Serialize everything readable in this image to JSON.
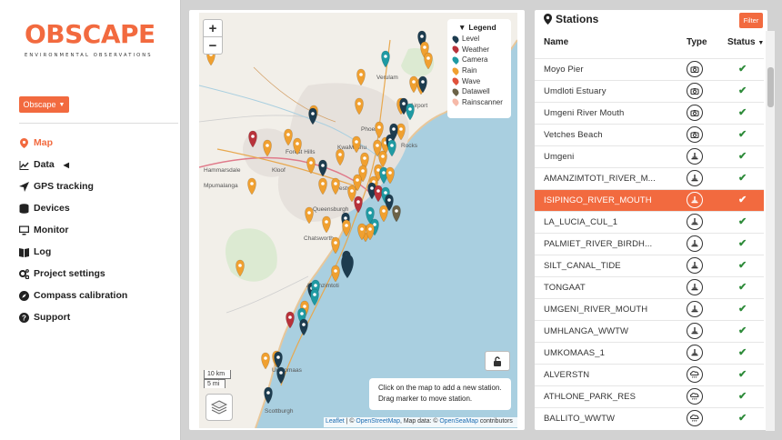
{
  "brand": {
    "name": "OBSCAPE",
    "tagline": "ENVIRONMENTAL OBSERVATIONS",
    "accent": "#f26a3f"
  },
  "org_select": {
    "label": "Obscape"
  },
  "nav": [
    {
      "label": "Map",
      "icon": "map-marker-icon",
      "active": true
    },
    {
      "label": "Data",
      "icon": "chart-icon",
      "expand": "◀"
    },
    {
      "label": "GPS tracking",
      "icon": "location-arrow-icon"
    },
    {
      "label": "Devices",
      "icon": "database-icon"
    },
    {
      "label": "Monitor",
      "icon": "monitor-icon"
    },
    {
      "label": "Log",
      "icon": "book-icon"
    },
    {
      "label": "Project settings",
      "icon": "cogs-icon"
    },
    {
      "label": "Compass calibration",
      "icon": "compass-icon"
    },
    {
      "label": "Support",
      "icon": "question-circle-icon"
    }
  ],
  "map": {
    "zoom_in": "+",
    "zoom_out": "−",
    "legend": {
      "title": "Legend",
      "items": [
        {
          "label": "Level",
          "color": "#1d3c4f"
        },
        {
          "label": "Weather",
          "color": "#b8323a"
        },
        {
          "label": "Camera",
          "color": "#1f9aa3"
        },
        {
          "label": "Rain",
          "color": "#f0a030"
        },
        {
          "label": "Wave",
          "color": "#e0523b"
        },
        {
          "label": "Datawell",
          "color": "#6b6247"
        },
        {
          "label": "Rainscanner",
          "color": "#f6b9a8"
        }
      ]
    },
    "hint_line1": "Click on the map to add a new station.",
    "hint_line2": "Drag marker to move station.",
    "scale_km": "10 km",
    "scale_mi": "5 mi",
    "attribution": {
      "leaflet": "Leaflet",
      "sep1": " | © ",
      "osm": "OpenStreetMap",
      "mid": ", Map data: © ",
      "osm2": "OpenSeaMap",
      "tail": " contributors"
    },
    "place_labels": [
      "Verulam",
      "Phoenix",
      "KwaMashu",
      "Forest Hills",
      "Kloof",
      "Westville",
      "Queensburgh",
      "Chatsworth",
      "Amanzimtoti",
      "Umkomaas",
      "Scottburgh",
      "Mpumalanga",
      "Hammarsdale",
      "Rocks",
      "Airport"
    ]
  },
  "stations": {
    "title": "Stations",
    "filter_label": "Filter",
    "col_name": "Name",
    "col_type": "Type",
    "col_status": "Status",
    "sort_icon": "▼",
    "rows": [
      {
        "name": "Moyo Pier",
        "type": "camera",
        "status": "✔",
        "selected": false
      },
      {
        "name": "Umdloti Estuary",
        "type": "camera",
        "status": "✔",
        "selected": false
      },
      {
        "name": "Umgeni River Mouth",
        "type": "camera",
        "status": "✔",
        "selected": false
      },
      {
        "name": "Vetches Beach",
        "type": "camera",
        "status": "✔",
        "selected": false
      },
      {
        "name": "Umgeni",
        "type": "level",
        "status": "✔",
        "selected": false
      },
      {
        "name": "AMANZIMTOTI_RIVER_M...",
        "type": "level",
        "status": "✔",
        "selected": false
      },
      {
        "name": "ISIPINGO_RIVER_MOUTH",
        "type": "level",
        "status": "✔",
        "selected": true
      },
      {
        "name": "LA_LUCIA_CUL_1",
        "type": "level",
        "status": "✔",
        "selected": false
      },
      {
        "name": "PALMIET_RIVER_BIRDH...",
        "type": "level",
        "status": "✔",
        "selected": false
      },
      {
        "name": "SILT_CANAL_TIDE",
        "type": "level",
        "status": "✔",
        "selected": false
      },
      {
        "name": "TONGAAT",
        "type": "level",
        "status": "✔",
        "selected": false
      },
      {
        "name": "UMGENI_RIVER_MOUTH",
        "type": "level",
        "status": "✔",
        "selected": false
      },
      {
        "name": "UMHLANGA_WWTW",
        "type": "level",
        "status": "✔",
        "selected": false
      },
      {
        "name": "UMKOMAAS_1",
        "type": "level",
        "status": "✔",
        "selected": false
      },
      {
        "name": "ALVERSTN",
        "type": "rain",
        "status": "✔",
        "selected": false
      },
      {
        "name": "ATHLONE_PARK_RES",
        "type": "rain",
        "status": "✔",
        "selected": false
      },
      {
        "name": "BALLITO_WWTW",
        "type": "rain",
        "status": "✔",
        "selected": false
      }
    ]
  }
}
